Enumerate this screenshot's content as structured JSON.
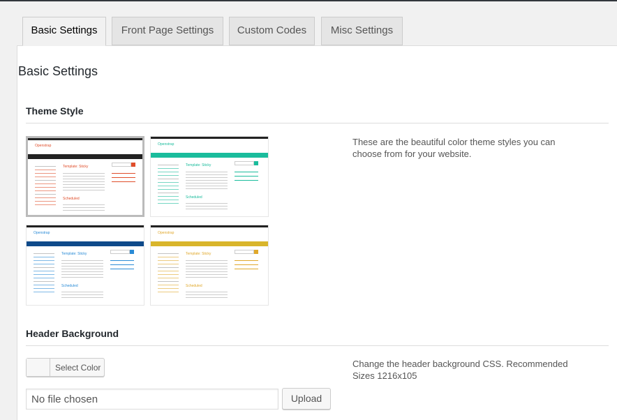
{
  "tabs": [
    {
      "label": "Basic Settings",
      "active": true
    },
    {
      "label": "Front Page Settings",
      "active": false
    },
    {
      "label": "Custom Codes",
      "active": false
    },
    {
      "label": "Misc Settings",
      "active": false
    }
  ],
  "page": {
    "title": "Basic Settings"
  },
  "theme_style": {
    "title": "Theme Style",
    "description": "These are the beautiful color theme styles you can choose from for your website.",
    "themes": [
      {
        "name": "red-theme",
        "brand": "Openstrap",
        "post_title": "Template: Sticky",
        "nav_color": "#222222",
        "accent": "#e04e2b",
        "selected": true
      },
      {
        "name": "teal-theme",
        "brand": "Openstrap",
        "post_title": "Template: Sticky",
        "nav_color": "#1abc9c",
        "accent": "#1abc9c",
        "selected": false
      },
      {
        "name": "blue-theme",
        "brand": "Openstrap",
        "post_title": "Template: Sticky",
        "nav_color": "#0e4a8a",
        "accent": "#2a8bd6",
        "selected": false
      },
      {
        "name": "yellow-theme",
        "brand": "Openstrap",
        "post_title": "Template: Sticky",
        "nav_color": "#d9b52b",
        "accent": "#e0a82b",
        "selected": false
      }
    ]
  },
  "header_background": {
    "title": "Header Background",
    "description": "Change the header background CSS. Recommended Sizes 1216x105",
    "select_color_label": "Select Color",
    "file_input_value": "No file chosen",
    "upload_label": "Upload"
  }
}
